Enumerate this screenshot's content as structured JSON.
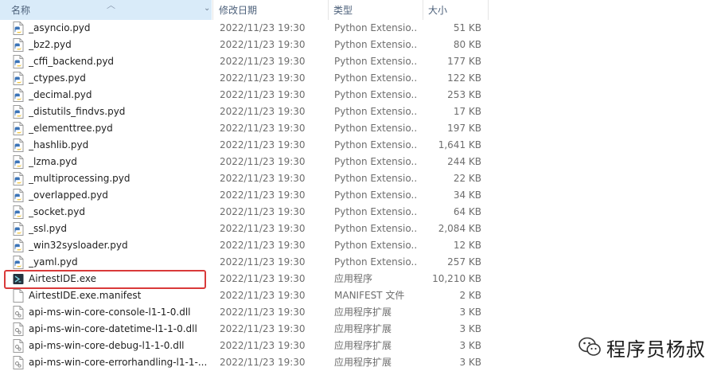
{
  "header": {
    "name": "名称",
    "date": "修改日期",
    "type": "类型",
    "size": "大小"
  },
  "files": [
    {
      "name": "_asyncio.pyd",
      "date": "2022/11/23 19:30",
      "type": "Python Extensio...",
      "size": "51 KB",
      "icon": "python-file-icon"
    },
    {
      "name": "_bz2.pyd",
      "date": "2022/11/23 19:30",
      "type": "Python Extensio...",
      "size": "80 KB",
      "icon": "python-file-icon"
    },
    {
      "name": "_cffi_backend.pyd",
      "date": "2022/11/23 19:30",
      "type": "Python Extensio...",
      "size": "177 KB",
      "icon": "python-file-icon"
    },
    {
      "name": "_ctypes.pyd",
      "date": "2022/11/23 19:30",
      "type": "Python Extensio...",
      "size": "122 KB",
      "icon": "python-file-icon"
    },
    {
      "name": "_decimal.pyd",
      "date": "2022/11/23 19:30",
      "type": "Python Extensio...",
      "size": "253 KB",
      "icon": "python-file-icon"
    },
    {
      "name": "_distutils_findvs.pyd",
      "date": "2022/11/23 19:30",
      "type": "Python Extensio...",
      "size": "17 KB",
      "icon": "python-file-icon"
    },
    {
      "name": "_elementtree.pyd",
      "date": "2022/11/23 19:30",
      "type": "Python Extensio...",
      "size": "197 KB",
      "icon": "python-file-icon"
    },
    {
      "name": "_hashlib.pyd",
      "date": "2022/11/23 19:30",
      "type": "Python Extensio...",
      "size": "1,641 KB",
      "icon": "python-file-icon"
    },
    {
      "name": "_lzma.pyd",
      "date": "2022/11/23 19:30",
      "type": "Python Extensio...",
      "size": "244 KB",
      "icon": "python-file-icon"
    },
    {
      "name": "_multiprocessing.pyd",
      "date": "2022/11/23 19:30",
      "type": "Python Extensio...",
      "size": "22 KB",
      "icon": "python-file-icon"
    },
    {
      "name": "_overlapped.pyd",
      "date": "2022/11/23 19:30",
      "type": "Python Extensio...",
      "size": "34 KB",
      "icon": "python-file-icon"
    },
    {
      "name": "_socket.pyd",
      "date": "2022/11/23 19:30",
      "type": "Python Extensio...",
      "size": "64 KB",
      "icon": "python-file-icon"
    },
    {
      "name": "_ssl.pyd",
      "date": "2022/11/23 19:30",
      "type": "Python Extensio...",
      "size": "2,084 KB",
      "icon": "python-file-icon"
    },
    {
      "name": "_win32sysloader.pyd",
      "date": "2022/11/23 19:30",
      "type": "Python Extensio...",
      "size": "12 KB",
      "icon": "python-file-icon"
    },
    {
      "name": "_yaml.pyd",
      "date": "2022/11/23 19:30",
      "type": "Python Extensio...",
      "size": "257 KB",
      "icon": "python-file-icon"
    },
    {
      "name": "AirtestIDE.exe",
      "date": "2022/11/23 19:30",
      "type": "应用程序",
      "size": "10,210 KB",
      "icon": "app-exe-icon"
    },
    {
      "name": "AirtestIDE.exe.manifest",
      "date": "2022/11/23 19:30",
      "type": "MANIFEST 文件",
      "size": "2 KB",
      "icon": "blank-file-icon"
    },
    {
      "name": "api-ms-win-core-console-l1-1-0.dll",
      "date": "2022/11/23 19:30",
      "type": "应用程序扩展",
      "size": "3 KB",
      "icon": "dll-file-icon"
    },
    {
      "name": "api-ms-win-core-datetime-l1-1-0.dll",
      "date": "2022/11/23 19:30",
      "type": "应用程序扩展",
      "size": "3 KB",
      "icon": "dll-file-icon"
    },
    {
      "name": "api-ms-win-core-debug-l1-1-0.dll",
      "date": "2022/11/23 19:30",
      "type": "应用程序扩展",
      "size": "3 KB",
      "icon": "dll-file-icon"
    },
    {
      "name": "api-ms-win-core-errorhandling-l1-1-...",
      "date": "2022/11/23 19:30",
      "type": "应用程序扩展",
      "size": "3 KB",
      "icon": "dll-file-icon"
    }
  ],
  "watermark": {
    "text": "程序员杨叔",
    "icon": "wechat-icon"
  },
  "colors": {
    "header_selected": "#d9ebf9",
    "highlight_border": "#d93a3a"
  }
}
